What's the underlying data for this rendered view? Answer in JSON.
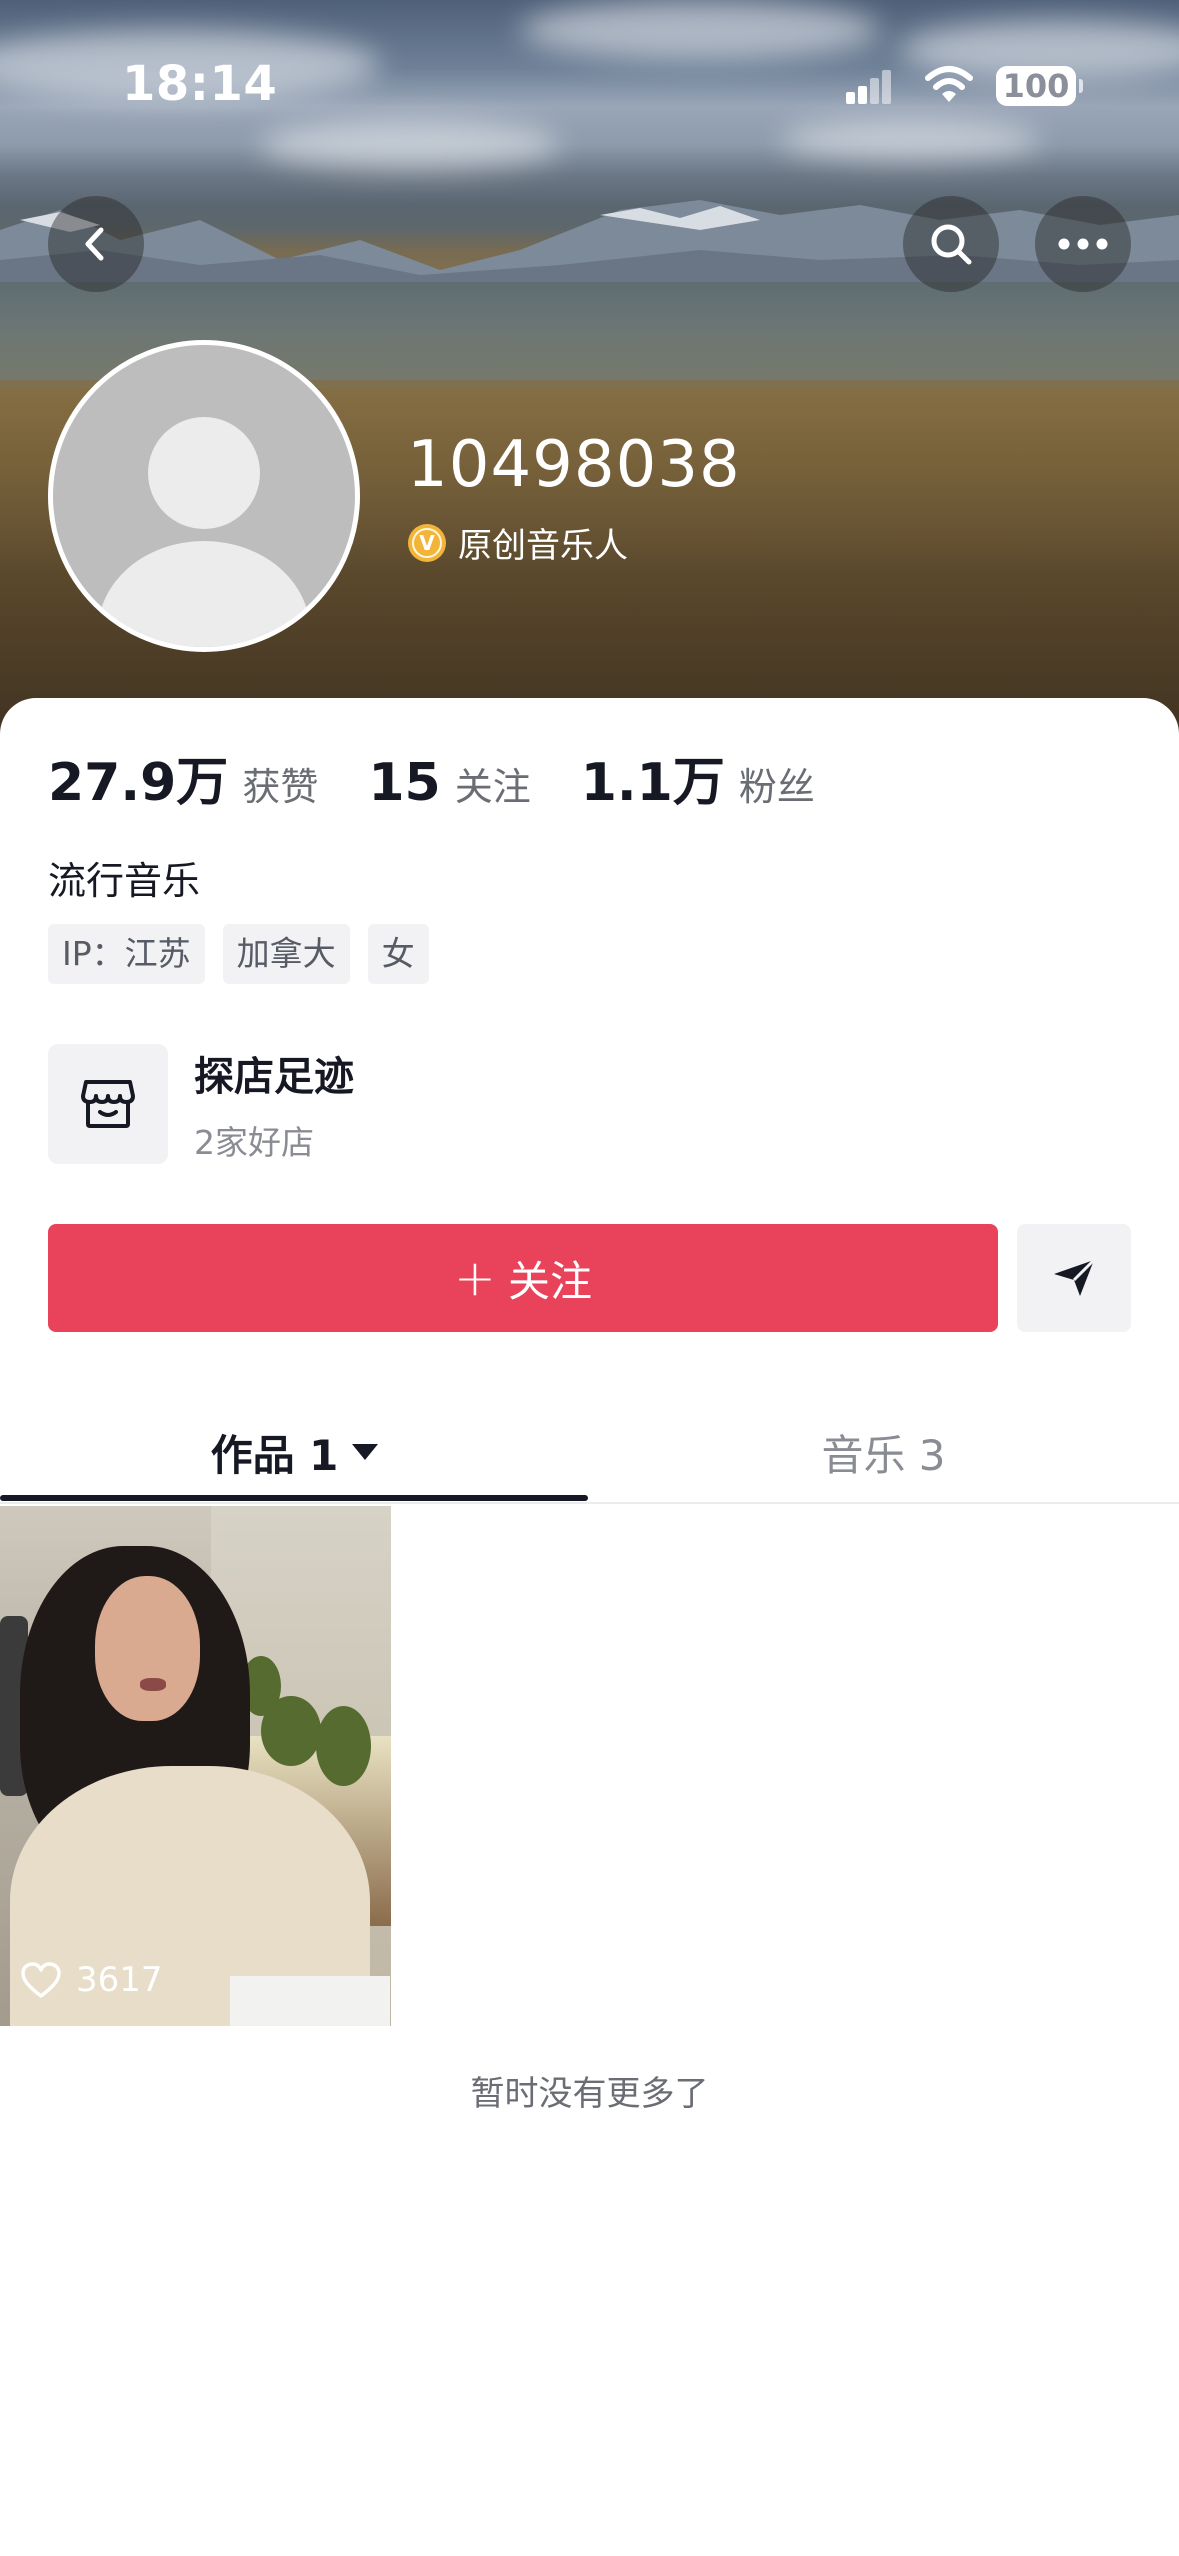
{
  "status_bar": {
    "time": "18:14",
    "battery": "100"
  },
  "profile": {
    "username": "10498038",
    "verification": "原创音乐人",
    "verify_icon": "v-badge-icon",
    "bio": "流行音乐",
    "tags": [
      "IP：江苏",
      "加拿大",
      "女"
    ]
  },
  "stats": [
    {
      "value": "27.9万",
      "label": "获赞"
    },
    {
      "value": "15",
      "label": "关注"
    },
    {
      "value": "1.1万",
      "label": "粉丝"
    }
  ],
  "shop": {
    "title": "探店足迹",
    "subtitle": "2家好店",
    "icon": "shop-icon"
  },
  "actions": {
    "follow_plus": "+",
    "follow_label": "关注",
    "share_icon": "send-icon"
  },
  "tabs": [
    {
      "label": "作品 1",
      "active": true
    },
    {
      "label": "音乐 3",
      "active": false
    }
  ],
  "videos": [
    {
      "likes": "3617"
    }
  ],
  "footer": {
    "no_more": "暂时没有更多了"
  },
  "colors": {
    "accent": "#e8435a",
    "verify": "#f3b43a",
    "text": "#161823",
    "muted": "#8a8c93"
  }
}
